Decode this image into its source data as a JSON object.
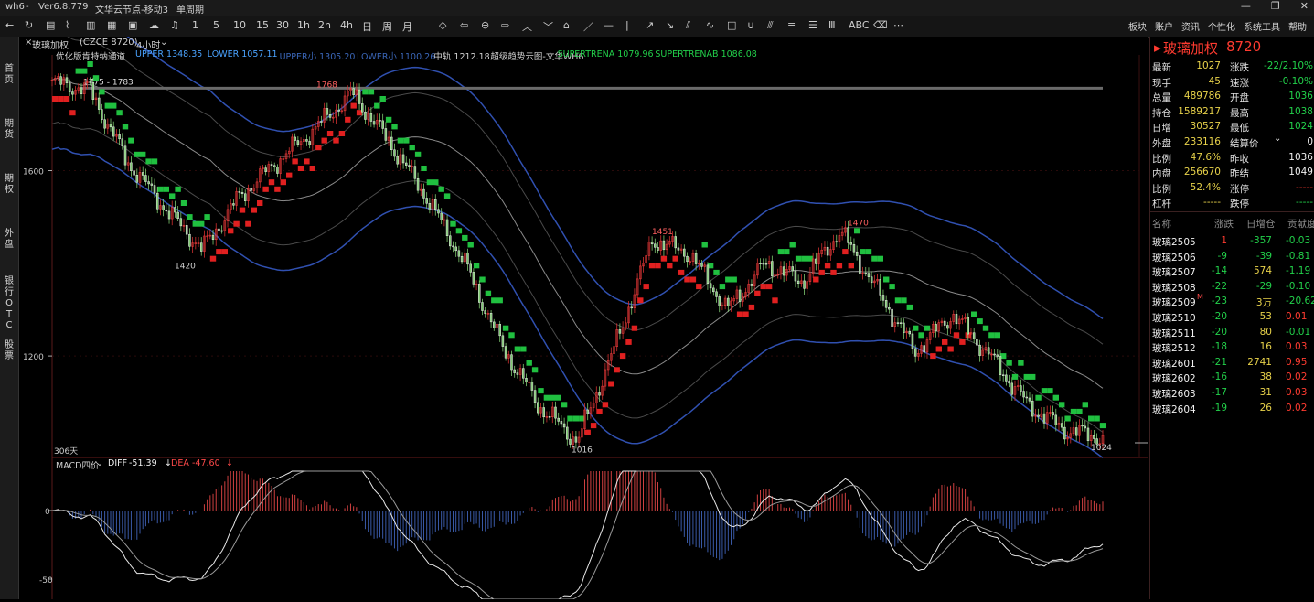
{
  "window": {
    "app": "wh6",
    "version": "Ver6.8.779",
    "node": "文华云节点-移动3",
    "cycle": "单周期",
    "controls": [
      "—",
      "❐",
      "✕"
    ]
  },
  "top_menu": [
    "板块",
    "账户",
    "资讯",
    "个性化",
    "系统工具",
    "帮助"
  ],
  "toolbar_periods": [
    "1",
    "5",
    "10",
    "15",
    "30",
    "1h",
    "2h",
    "4h",
    "日",
    "周",
    "月"
  ],
  "left_nav": [
    "首页",
    "期货",
    "期权",
    "外盘",
    "银行OTC",
    "股票"
  ],
  "chart_header": {
    "symbol": "玻璃加权",
    "code": "(CZCE 8720)",
    "period": "4小时"
  },
  "indicator_line": {
    "name": "优化版肯特纳通道",
    "items": [
      {
        "label": "UPPER",
        "value": "1348.35",
        "color": "#4aa3ff"
      },
      {
        "label": "LOWER",
        "value": "1057.11",
        "color": "#4aa3ff"
      },
      {
        "label": "UPPER小",
        "value": "1305.20",
        "color": "#3a66b8"
      },
      {
        "label": "LOWER小",
        "value": "1100.26",
        "color": "#3a66b8"
      },
      {
        "label": "中轨",
        "value": "1212.18",
        "color": "#d0d0d0"
      },
      {
        "label": "超级趋势云图-文华WH6",
        "value": "",
        "color": "#d0d0d0"
      },
      {
        "label": "SUPERTRENA",
        "value": "1079.96",
        "color": "#22d04a"
      },
      {
        "label": "SUPERTRENAB",
        "value": "1086.08",
        "color": "#22d04a"
      }
    ]
  },
  "price_axis": {
    "labels": [
      "1600",
      "1200"
    ],
    "ylim": [
      985,
      1830
    ]
  },
  "price_annotations": {
    "box_label": "1775 - 1783",
    "highs": [
      "1768",
      "1451",
      "1470"
    ],
    "lows": [
      "1420",
      "1016",
      "1024"
    ],
    "days": "306天"
  },
  "macd": {
    "name": "MACD四价",
    "diff_label": "DIFF",
    "diff": "-51.39",
    "dea_label": "DEA",
    "dea": "-47.60",
    "axis_labels": [
      "0",
      "-50"
    ]
  },
  "quote": {
    "title": "玻璃加权",
    "code": "8720",
    "rows": [
      [
        {
          "l": "最新",
          "v": "1027",
          "c": "yel"
        },
        {
          "l": "涨跌",
          "v": "-22/2.10%",
          "c": "grn"
        }
      ],
      [
        {
          "l": "现手",
          "v": "45",
          "c": "yel"
        },
        {
          "l": "速涨",
          "v": "-0.10%",
          "c": "grn"
        }
      ],
      [
        {
          "l": "总量",
          "v": "489786",
          "c": "yel"
        },
        {
          "l": "开盘",
          "v": "1036",
          "c": "grn"
        }
      ],
      [
        {
          "l": "持仓",
          "v": "1589217",
          "c": "yel"
        },
        {
          "l": "最高",
          "v": "1038",
          "c": "grn"
        }
      ],
      [
        {
          "l": "日增",
          "v": "30527",
          "c": "yel"
        },
        {
          "l": "最低",
          "v": "1024",
          "c": "grn"
        }
      ],
      [
        {
          "l": "外盘",
          "v": "233116",
          "c": "yel"
        },
        {
          "l": "结算价",
          "v": "0",
          "c": "wht"
        }
      ],
      [
        {
          "l": "比例",
          "v": "47.6%",
          "c": "yel"
        },
        {
          "l": "昨收",
          "v": "1036",
          "c": "wht"
        }
      ],
      [
        {
          "l": "内盘",
          "v": "256670",
          "c": "yel"
        },
        {
          "l": "昨结",
          "v": "1049",
          "c": "wht"
        }
      ],
      [
        {
          "l": "比例",
          "v": "52.4%",
          "c": "yel"
        },
        {
          "l": "涨停",
          "v": "-----",
          "c": "red"
        }
      ],
      [
        {
          "l": "杠杆",
          "v": "-----",
          "c": "yel"
        },
        {
          "l": "跌停",
          "v": "-----",
          "c": "grn"
        }
      ]
    ]
  },
  "contracts": {
    "headers": [
      "名称",
      "涨跌",
      "日增仓",
      "贡献度"
    ],
    "rows": [
      {
        "name": "玻璃2505",
        "chg": "1",
        "oi": "-357",
        "contrib": "-0.03",
        "chgc": "red",
        "oic": "grn",
        "cc": "grn"
      },
      {
        "name": "玻璃2506",
        "chg": "-9",
        "oi": "-39",
        "contrib": "-0.81",
        "chgc": "grn",
        "oic": "grn",
        "cc": "grn"
      },
      {
        "name": "玻璃2507",
        "chg": "-14",
        "oi": "574",
        "contrib": "-1.19",
        "chgc": "grn",
        "oic": "yel",
        "cc": "grn"
      },
      {
        "name": "玻璃2508",
        "chg": "-22",
        "oi": "-29",
        "contrib": "-0.10",
        "chgc": "grn",
        "oic": "grn",
        "cc": "grn"
      },
      {
        "name": "玻璃2509",
        "tag": "M",
        "chg": "-23",
        "oi": "3万",
        "contrib": "-20.62",
        "chgc": "grn",
        "oic": "yel",
        "cc": "grn"
      },
      {
        "name": "玻璃2510",
        "chg": "-20",
        "oi": "53",
        "contrib": "0.01",
        "chgc": "grn",
        "oic": "yel",
        "cc": "red"
      },
      {
        "name": "玻璃2511",
        "chg": "-20",
        "oi": "80",
        "contrib": "-0.01",
        "chgc": "grn",
        "oic": "yel",
        "cc": "grn"
      },
      {
        "name": "玻璃2512",
        "chg": "-18",
        "oi": "16",
        "contrib": "0.03",
        "chgc": "grn",
        "oic": "yel",
        "cc": "red"
      },
      {
        "name": "玻璃2601",
        "chg": "-21",
        "oi": "2741",
        "contrib": "0.95",
        "chgc": "grn",
        "oic": "yel",
        "cc": "red"
      },
      {
        "name": "玻璃2602",
        "chg": "-16",
        "oi": "38",
        "contrib": "0.02",
        "chgc": "grn",
        "oic": "yel",
        "cc": "red"
      },
      {
        "name": "玻璃2603",
        "chg": "-17",
        "oi": "31",
        "contrib": "0.03",
        "chgc": "grn",
        "oic": "yel",
        "cc": "red"
      },
      {
        "name": "玻璃2604",
        "chg": "-19",
        "oi": "26",
        "contrib": "0.02",
        "chgc": "grn",
        "oic": "yel",
        "cc": "red"
      }
    ]
  },
  "chart_data": {
    "type": "line",
    "price_waypoints": [
      1790,
      1775,
      1620,
      1520,
      1430,
      1545,
      1620,
      1690,
      1768,
      1660,
      1540,
      1400,
      1220,
      1090,
      1016,
      1220,
      1451,
      1420,
      1300,
      1400,
      1360,
      1470,
      1340,
      1210,
      1290,
      1200,
      1095,
      1040,
      1024
    ],
    "ylim": [
      985,
      1830
    ]
  }
}
